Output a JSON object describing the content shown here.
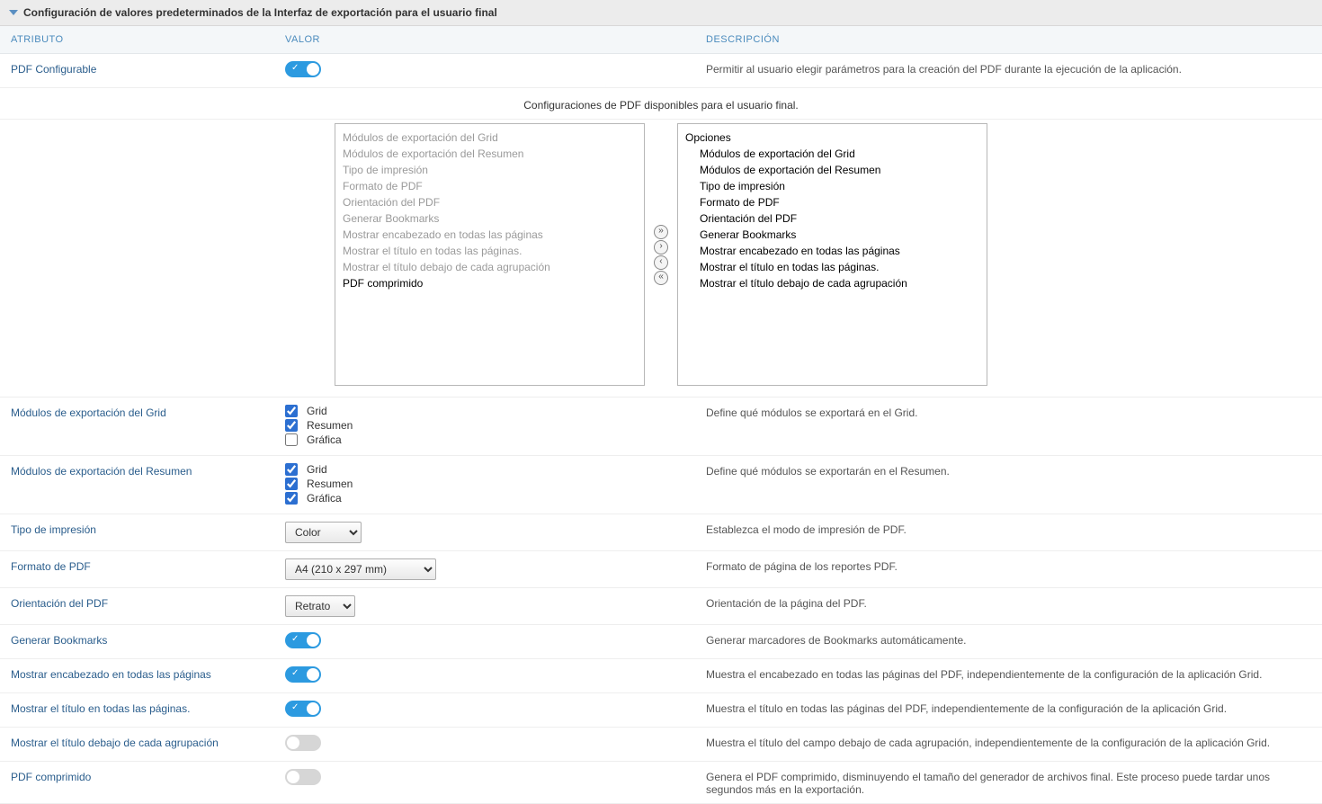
{
  "header": {
    "title": "Configuración de valores predeterminados de la Interfaz de exportación para el usuario final"
  },
  "columns": {
    "attr": "ATRIBUTO",
    "val": "VALOR",
    "desc": "DESCRIPCIÓN"
  },
  "rows": {
    "pdfConfigurable": {
      "label": "PDF Configurable",
      "on": true,
      "desc": "Permitir al usuario elegir parámetros para la creación del PDF durante la ejecución de la aplicación."
    },
    "subtitle": "Configuraciones de PDF disponibles para el usuario final.",
    "leftList": [
      {
        "text": "Módulos de exportación del Grid",
        "disabled": true
      },
      {
        "text": "Módulos de exportación del Resumen",
        "disabled": true
      },
      {
        "text": "Tipo de impresión",
        "disabled": true
      },
      {
        "text": "Formato de PDF",
        "disabled": true
      },
      {
        "text": "Orientación del PDF",
        "disabled": true
      },
      {
        "text": "Generar Bookmarks",
        "disabled": true
      },
      {
        "text": "Mostrar encabezado en todas las páginas",
        "disabled": true
      },
      {
        "text": "Mostrar el título en todas las páginas.",
        "disabled": true
      },
      {
        "text": "Mostrar el título debajo de cada agrupación",
        "disabled": true
      },
      {
        "text": "PDF comprimido",
        "disabled": false
      }
    ],
    "rightList": {
      "group": "Opciones",
      "items": [
        "Módulos de exportación del Grid",
        "Módulos de exportación del Resumen",
        "Tipo de impresión",
        "Formato de PDF",
        "Orientación del PDF",
        "Generar Bookmarks",
        "Mostrar encabezado en todas las páginas",
        "Mostrar el título en todas las páginas.",
        "Mostrar el título debajo de cada agrupación"
      ]
    },
    "gridModules": {
      "label": "Módulos de exportación del Grid",
      "opts": [
        {
          "label": "Grid",
          "checked": true
        },
        {
          "label": "Resumen",
          "checked": true
        },
        {
          "label": "Gráfica",
          "checked": false
        }
      ],
      "desc": "Define qué módulos se exportará en el Grid."
    },
    "summaryModules": {
      "label": "Módulos de exportación del Resumen",
      "opts": [
        {
          "label": "Grid",
          "checked": true
        },
        {
          "label": "Resumen",
          "checked": true
        },
        {
          "label": "Gráfica",
          "checked": true
        }
      ],
      "desc": "Define qué módulos se exportarán en el Resumen."
    },
    "printType": {
      "label": "Tipo de impresión",
      "value": "Color",
      "desc": "Establezca el modo de impresión de PDF."
    },
    "pdfFormat": {
      "label": "Formato de PDF",
      "value": "A4 (210 x 297 mm)",
      "desc": "Formato de página de los reportes PDF."
    },
    "orientation": {
      "label": "Orientación del PDF",
      "value": "Retrato",
      "desc": "Orientación de la página del PDF."
    },
    "bookmarks": {
      "label": "Generar Bookmarks",
      "on": true,
      "desc": "Generar marcadores de Bookmarks automáticamente."
    },
    "headerAll": {
      "label": "Mostrar encabezado en todas las páginas",
      "on": true,
      "desc": "Muestra el encabezado en todas las páginas del PDF, independientemente de la configuración de la aplicación Grid."
    },
    "titleAll": {
      "label": "Mostrar el título en todas las páginas.",
      "on": true,
      "desc": "Muestra el título en todas las páginas del PDF, independientemente de la configuración de la aplicación Grid."
    },
    "titleGroup": {
      "label": "Mostrar el título debajo de cada agrupación",
      "on": false,
      "desc": "Muestra el título del campo debajo de cada agrupación, independientemente de la configuración de la aplicación Grid."
    },
    "compressed": {
      "label": "PDF comprimido",
      "on": false,
      "desc": "Genera el PDF comprimido, disminuyendo el tamaño del generador de archivos final. Este proceso puede tardar unos segundos más en la exportación."
    }
  }
}
